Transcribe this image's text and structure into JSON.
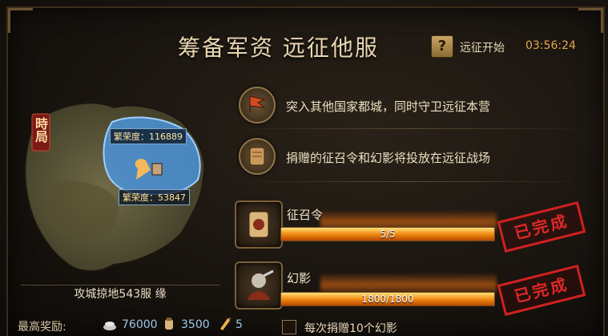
{
  "header": {
    "title": "筹备军资 远征他服",
    "help_label": "?",
    "timer_label": "远征开始",
    "timer_value": "03:56:24"
  },
  "map": {
    "server_badge": "時局",
    "enemy_prosperity": "繁荣度：116889",
    "own_prosperity": "繁荣度：53847",
    "guild_line": "攻城掠地543服 缘"
  },
  "tasks": [
    {
      "text": "突入其他国家都城，同时守卫远征本营",
      "icon": "flag-icon"
    },
    {
      "text": "捐赠的征召令和幻影将投放在远征战场",
      "icon": "scroll-icon"
    }
  ],
  "items": [
    {
      "name": "征召令",
      "progress_text": "5/5",
      "progress": 1.0,
      "stamp": "已完成",
      "icon": "recruit-order-icon"
    },
    {
      "name": "幻影",
      "progress_text": "1800/1800",
      "progress": 1.0,
      "stamp": "已完成",
      "icon": "phantom-icon"
    }
  ],
  "rewards": {
    "label": "最高奖励:",
    "values": [
      "76000",
      "3500",
      "5"
    ],
    "icons": [
      "silver-icon",
      "food-icon",
      "token-icon"
    ]
  },
  "donate_option": {
    "label": "每次捐赠10个幻影",
    "checked": false
  },
  "colors": {
    "accent": "#e6a64a",
    "stamp": "#d02020",
    "bar": "#f08a12"
  }
}
